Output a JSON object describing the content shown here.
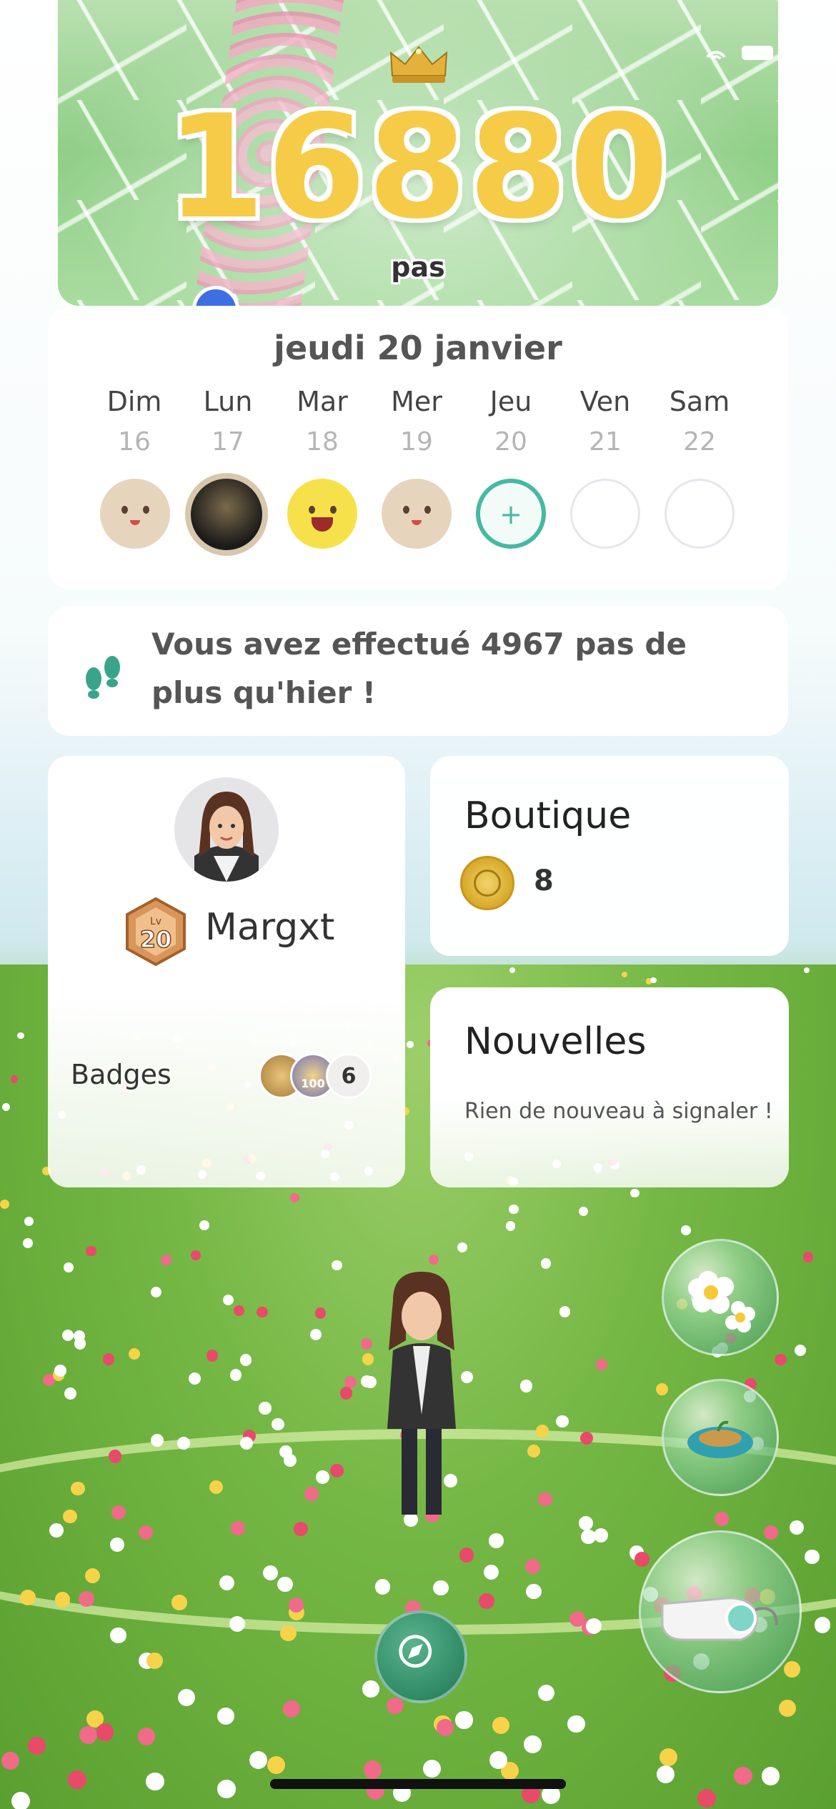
{
  "header": {
    "steps": "16880",
    "steps_unit": "pas"
  },
  "calendar": {
    "date_title": "jeudi 20 janvier",
    "days": [
      {
        "name": "Dim",
        "num": "16",
        "state": "logged"
      },
      {
        "name": "Lun",
        "num": "17",
        "state": "photo"
      },
      {
        "name": "Mar",
        "num": "18",
        "state": "goal-met"
      },
      {
        "name": "Mer",
        "num": "19",
        "state": "logged"
      },
      {
        "name": "Jeu",
        "num": "20",
        "state": "today",
        "symbol": "+"
      },
      {
        "name": "Ven",
        "num": "21",
        "state": "empty"
      },
      {
        "name": "Sam",
        "num": "22",
        "state": "empty"
      }
    ]
  },
  "comparison": {
    "text": "Vous avez effectué 4967 pas de plus qu'hier !",
    "icon": "footprints-icon"
  },
  "profile": {
    "username": "Margxt",
    "level_prefix": "Lv",
    "level": "20",
    "badges_label": "Badges",
    "badges_extra_count": "6",
    "badge_medal_text": "100"
  },
  "shop": {
    "title": "Boutique",
    "coins": "8"
  },
  "news": {
    "title": "Nouvelles",
    "empty_message": "Rien de nouveau à signaler !"
  },
  "actions": [
    {
      "icon": "flowers-icon"
    },
    {
      "icon": "pot-icon"
    },
    {
      "icon": "whistle-icon"
    },
    {
      "icon": "compass-icon"
    }
  ],
  "colors": {
    "accent": "#46b9a1",
    "steps": "#f5cb48"
  }
}
